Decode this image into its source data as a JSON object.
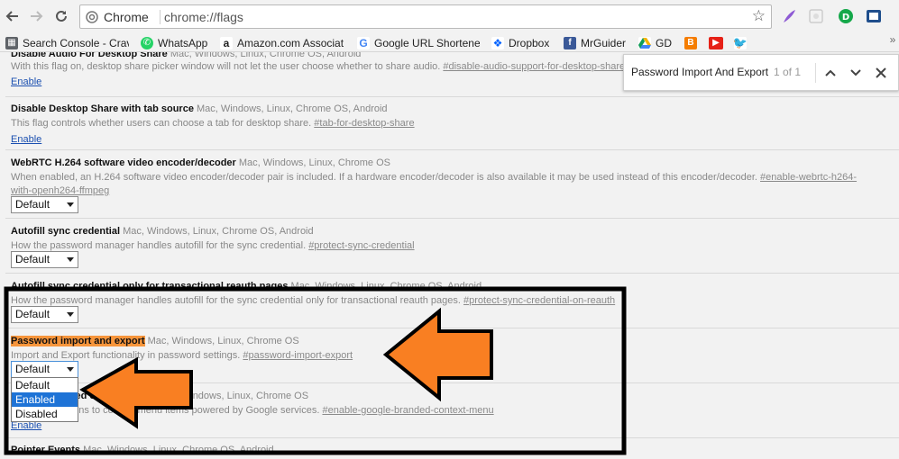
{
  "toolbar": {
    "site_chip": "Chrome",
    "url": "chrome://flags"
  },
  "bookmarks": [
    {
      "label": "Search Console - Crav",
      "icon": "search-console-icon",
      "color": "#5f6368"
    },
    {
      "label": "WhatsApp",
      "icon": "whatsapp-icon",
      "color": "#25d366"
    },
    {
      "label": "Amazon.com Associat",
      "icon": "amazon-icon",
      "color": "#222222"
    },
    {
      "label": "Google URL Shortene",
      "icon": "google-icon",
      "color": "#4285f4"
    },
    {
      "label": "Dropbox",
      "icon": "dropbox-icon",
      "color": "#0061fe"
    },
    {
      "label": "MrGuider",
      "icon": "facebook-icon",
      "color": "#3b5998"
    },
    {
      "label": "GD",
      "icon": "google-drive-icon",
      "color": "#0f9d58"
    },
    {
      "label": "",
      "icon": "blogger-icon",
      "color": "#f57d00"
    },
    {
      "label": "",
      "icon": "youtube-icon",
      "color": "#e62117"
    },
    {
      "label": "",
      "icon": "twitter-icon",
      "color": "#1da1f2"
    }
  ],
  "find": {
    "query": "Password Import And Export",
    "count": "1 of 1"
  },
  "flags": [
    {
      "title": "Disable Audio For Desktop Share",
      "platforms": "Mac, Windows, Linux, Chrome OS, Android",
      "description": "With this flag on, desktop share picker window will not let the user choose whether to share audio.",
      "anchor": "#disable-audio-support-for-desktop-share",
      "link": "Enable"
    },
    {
      "title": "Disable Desktop Share with tab source",
      "platforms": "Mac, Windows, Linux, Chrome OS, Android",
      "description": "This flag controls whether users can choose a tab for desktop share.",
      "anchor": "#tab-for-desktop-share",
      "link": "Enable"
    },
    {
      "title": "WebRTC H.264 software video encoder/decoder",
      "platforms": "Mac, Windows, Linux, Chrome OS",
      "description": "When enabled, an H.264 software video encoder/decoder pair is included. If a hardware encoder/decoder is also available it may be used instead of this encoder/decoder.",
      "anchor": "#enable-webrtc-h264-with-openh264-ffmpeg",
      "select": "Default"
    },
    {
      "title": "Autofill sync credential",
      "platforms": "Mac, Windows, Linux, Chrome OS, Android",
      "description": "How the password manager handles autofill for the sync credential.",
      "anchor": "#protect-sync-credential",
      "select": "Default"
    },
    {
      "title": "Autofill sync credential only for transactional reauth pages",
      "platforms": "Mac, Windows, Linux, Chrome OS, Android",
      "description": "How the password manager handles autofill for the sync credential only for transactional reauth pages.",
      "anchor": "#protect-sync-credential-on-reauth",
      "select": "Default"
    },
    {
      "title": "Password import and export",
      "platforms": "Mac, Windows, Linux, Chrome OS",
      "description": "Import and Export functionality in password settings.",
      "anchor": "#password-import-export",
      "select": "Default",
      "options": [
        "Default",
        "Enabled",
        "Disabled"
      ],
      "highlighted_option": "Enabled"
    },
    {
      "title": "Google branded context menu",
      "platforms": "Mac, Windows, Linux, Chrome OS",
      "description": "Add Google icons to context menu items powered by Google services.",
      "anchor": "#enable-google-branded-context-menu",
      "link": "Enable"
    },
    {
      "title": "Pointer Events",
      "platforms": "Mac, Windows, Linux, Chrome OS, Android"
    }
  ],
  "colors": {
    "highlight": "#f7953b",
    "arrow": "#f97f22",
    "annotation_box": "#000000",
    "link": "#1a4fb0"
  }
}
